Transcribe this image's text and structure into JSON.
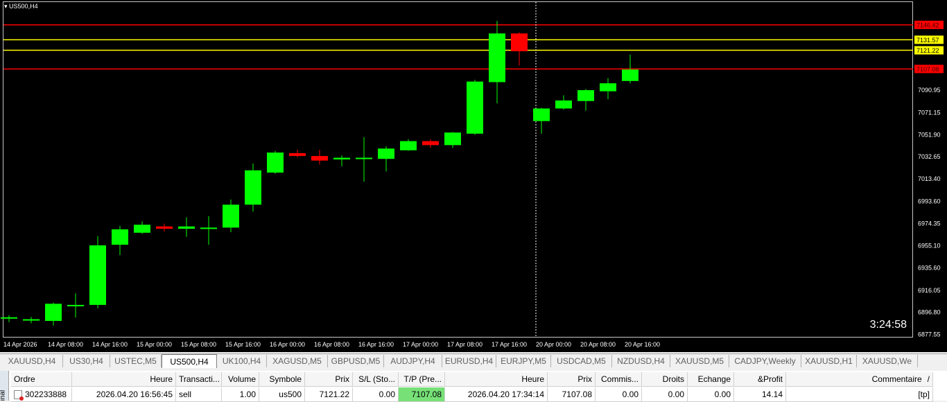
{
  "chart": {
    "symbol_title": "US500,H4",
    "timer": "3:24:58",
    "colors": {
      "background": "#000000",
      "bull": "#00ff00",
      "bear": "#ff0000",
      "axis_text": "#ffffff",
      "hline_red": "#ff0000",
      "hline_yellow": "#ffff00"
    },
    "price_labels": [
      "7090.95",
      "7071.15",
      "7051.90",
      "7032.65",
      "7013.40",
      "6993.60",
      "6974.35",
      "6955.10",
      "6935.60",
      "6916.05",
      "6896.80",
      "6877.55"
    ],
    "hlines": [
      {
        "label": "7146.42",
        "color": "red",
        "price": 7147.5
      },
      {
        "label": "7131.57",
        "color": "yellow",
        "price": 7134.5
      },
      {
        "label": "7121.22",
        "color": "yellow",
        "price": 7125.3
      },
      {
        "label": "7107.08",
        "color": "red",
        "price": 7109.0
      }
    ],
    "time_labels": [
      "14 Apr 2026",
      "14 Apr 08:00",
      "14 Apr 16:00",
      "15 Apr 00:00",
      "15 Apr 08:00",
      "15 Apr 16:00",
      "16 Apr 00:00",
      "16 Apr 08:00",
      "16 Apr 16:00",
      "17 Apr 00:00",
      "17 Apr 08:00",
      "17 Apr 16:00",
      "20 Apr 00:00",
      "20 Apr 08:00",
      "20 Apr 16:00"
    ]
  },
  "chart_data": {
    "type": "candlestick",
    "title": "US500,H4",
    "ylim": [
      6874.5,
      7168.0
    ],
    "candles": [
      {
        "o": 6892.2,
        "h": 6894.0,
        "l": 6888.0,
        "c": 6892.2
      },
      {
        "o": 6890.5,
        "h": 6892.5,
        "l": 6887.0,
        "c": 6890.5
      },
      {
        "o": 6889.0,
        "h": 6905.0,
        "l": 6885.0,
        "c": 6904.0
      },
      {
        "o": 6903.0,
        "h": 6913.0,
        "l": 6892.0,
        "c": 6903.0
      },
      {
        "o": 6903.0,
        "h": 6963.0,
        "l": 6900.0,
        "c": 6955.0
      },
      {
        "o": 6955.5,
        "h": 6972.0,
        "l": 6946.5,
        "c": 6969.0
      },
      {
        "o": 6966.0,
        "h": 6976.0,
        "l": 6965.0,
        "c": 6973.0
      },
      {
        "o": 6971.5,
        "h": 6974.0,
        "l": 6967.0,
        "c": 6969.5
      },
      {
        "o": 6969.5,
        "h": 6979.5,
        "l": 6962.5,
        "c": 6971.5
      },
      {
        "o": 6970.5,
        "h": 6980.5,
        "l": 6955.5,
        "c": 6970.5
      },
      {
        "o": 6970.5,
        "h": 6995.0,
        "l": 6966.5,
        "c": 6990.5
      },
      {
        "o": 6990.5,
        "h": 7026.5,
        "l": 6984.5,
        "c": 7020.5
      },
      {
        "o": 7018.5,
        "h": 7037.5,
        "l": 7017.5,
        "c": 7036.0
      },
      {
        "o": 7035.5,
        "h": 7038.5,
        "l": 7032.0,
        "c": 7033.0
      },
      {
        "o": 7033.0,
        "h": 7038.5,
        "l": 7025.5,
        "c": 7029.0
      },
      {
        "o": 7030.0,
        "h": 7033.5,
        "l": 7024.0,
        "c": 7031.5
      },
      {
        "o": 7031.5,
        "h": 7049.5,
        "l": 7010.5,
        "c": 7031.5
      },
      {
        "o": 7030.5,
        "h": 7041.5,
        "l": 7019.5,
        "c": 7039.5
      },
      {
        "o": 7038.0,
        "h": 7047.5,
        "l": 7037.5,
        "c": 7046.0
      },
      {
        "o": 7046.0,
        "h": 7047.5,
        "l": 7040.0,
        "c": 7042.5
      },
      {
        "o": 7042.5,
        "h": 7054.0,
        "l": 7040.0,
        "c": 7053.5
      },
      {
        "o": 7052.5,
        "h": 7099.5,
        "l": 7051.5,
        "c": 7098.0
      },
      {
        "o": 7097.5,
        "h": 7151.0,
        "l": 7079.0,
        "c": 7140.0
      },
      {
        "o": 7140.0,
        "h": 7141.0,
        "l": 7112.0,
        "c": 7124.5
      },
      {
        "o": 7063.5,
        "h": 7075.0,
        "l": 7052.5,
        "c": 7074.5
      },
      {
        "o": 7074.5,
        "h": 7086.0,
        "l": 7073.5,
        "c": 7081.5
      },
      {
        "o": 7081.0,
        "h": 7091.5,
        "l": 7072.5,
        "c": 7090.5
      },
      {
        "o": 7089.5,
        "h": 7101.0,
        "l": 7082.5,
        "c": 7096.5
      },
      {
        "o": 7098.5,
        "h": 7121.5,
        "l": 7096.5,
        "c": 7108.5
      }
    ]
  },
  "tabs": [
    "XAUUSD,H4",
    "US30,H4",
    "USTEC,M5",
    "US500,H4",
    "UK100,H4",
    "XAGUSD,M5",
    "GBPUSD,M5",
    "AUDJPY,H4",
    "EURUSD,H4",
    "EURJPY,M5",
    "USDCAD,M5",
    "NZDUSD,H4",
    "XAUUSD,M5",
    "CADJPY,Weekly",
    "XAUUSD,H1",
    "XAUUSD,We"
  ],
  "active_tab": "US500,H4",
  "terminal": {
    "side_label": "inal",
    "headers": [
      "Ordre",
      "Heure",
      "Transacti...",
      "Volume",
      "Symbole",
      "Prix",
      "S/L (Sto...",
      "T/P (Pre...",
      "Heure",
      "Prix",
      "Commis...",
      "Droits",
      "Echange",
      "&Profit",
      "Commentaire"
    ],
    "sort_indicator": "/",
    "row": [
      "302233888",
      "2026.04.20 16:56:45",
      "sell",
      "1.00",
      "us500",
      "7121.22",
      "0.00",
      "7107.08",
      "2026.04.20 17:34:14",
      "7107.08",
      "0.00",
      "0.00",
      "0.00",
      "14.14",
      "[tp]"
    ]
  }
}
